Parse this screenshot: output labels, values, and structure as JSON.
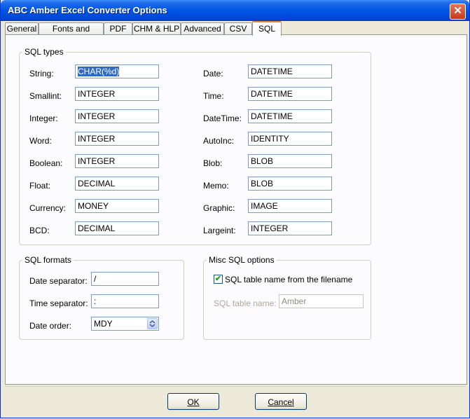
{
  "window": {
    "title": "ABC Amber Excel Converter Options",
    "close_symbol": "✕"
  },
  "tabs": [
    {
      "label": "General"
    },
    {
      "label": "Fonts and Colors"
    },
    {
      "label": "PDF"
    },
    {
      "label": "CHM & HLP"
    },
    {
      "label": "Advanced"
    },
    {
      "label": "CSV"
    },
    {
      "label": "SQL"
    }
  ],
  "active_tab": "SQL",
  "sql_types": {
    "title": "SQL types",
    "left": [
      {
        "label": "String:",
        "value": "CHAR(%d)"
      },
      {
        "label": "Smallint:",
        "value": "INTEGER"
      },
      {
        "label": "Integer:",
        "value": "INTEGER"
      },
      {
        "label": "Word:",
        "value": "INTEGER"
      },
      {
        "label": "Boolean:",
        "value": "INTEGER"
      },
      {
        "label": "Float:",
        "value": "DECIMAL"
      },
      {
        "label": "Currency:",
        "value": "MONEY"
      },
      {
        "label": "BCD:",
        "value": "DECIMAL"
      }
    ],
    "right": [
      {
        "label": "Date:",
        "value": "DATETIME"
      },
      {
        "label": "Time:",
        "value": "DATETIME"
      },
      {
        "label": "DateTime:",
        "value": "DATETIME"
      },
      {
        "label": "AutoInc:",
        "value": "IDENTITY"
      },
      {
        "label": "Blob:",
        "value": "BLOB"
      },
      {
        "label": "Memo:",
        "value": "BLOB"
      },
      {
        "label": "Graphic:",
        "value": "IMAGE"
      },
      {
        "label": "Largeint:",
        "value": "INTEGER"
      }
    ]
  },
  "sql_formats": {
    "title": "SQL formats",
    "date_separator_label": "Date separator:",
    "date_separator_value": "/",
    "time_separator_label": "Time separator:",
    "time_separator_value": ":",
    "date_order_label": "Date order:",
    "date_order_value": "MDY"
  },
  "misc": {
    "title": "Misc SQL options",
    "checkbox_label": "SQL table name from the filename",
    "checkbox_checked": true,
    "check_glyph": "✔",
    "table_name_label": "SQL table name:",
    "table_name_value": "Amber"
  },
  "buttons": {
    "ok": "OK",
    "cancel": "Cancel"
  },
  "colors": {
    "titlebar": "#0055e5",
    "active_tab_accent": "#e68b2c",
    "selection": "#316ac5"
  }
}
